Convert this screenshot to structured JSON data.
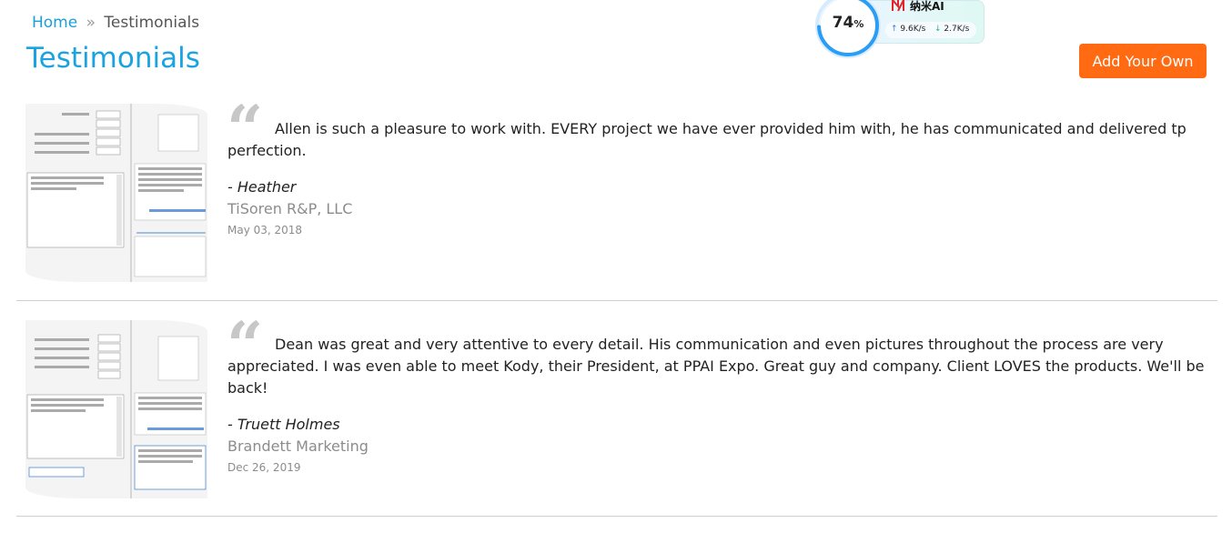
{
  "breadcrumb": {
    "home": "Home",
    "separator": "»",
    "current": "Testimonials"
  },
  "page": {
    "title": "Testimonials",
    "add_button": "Add Your Own"
  },
  "widget": {
    "percent": "74",
    "percent_unit": "%",
    "brand": "纳米AI",
    "upload": "9.6K/s",
    "download": "2.7K/s",
    "upload_icon": "arrow-up-icon",
    "download_icon": "arrow-down-icon",
    "accent": "#2a9df4"
  },
  "testimonials": [
    {
      "text": "Allen is such a pleasure to work with.  EVERY project we have ever provided him with, he has communicated and delivered tp perfection.",
      "author": "- Heather",
      "company": "TiSoren R&P, LLC",
      "date": "May 03, 2018"
    },
    {
      "text": "Dean was great and very attentive to every detail. His communication and even pictures throughout the process are very appreciated. I was even able to meet Kody, their President, at PPAI Expo. Great guy and company. Client LOVES the products. We'll be back!",
      "author": "- Truett Holmes",
      "company": "Brandett Marketing",
      "date": "Dec 26, 2019"
    }
  ],
  "colors": {
    "link": "#1a9fd6",
    "title": "#1aa3e0",
    "button": "#ff6a13",
    "muted": "#8c8c8c"
  }
}
